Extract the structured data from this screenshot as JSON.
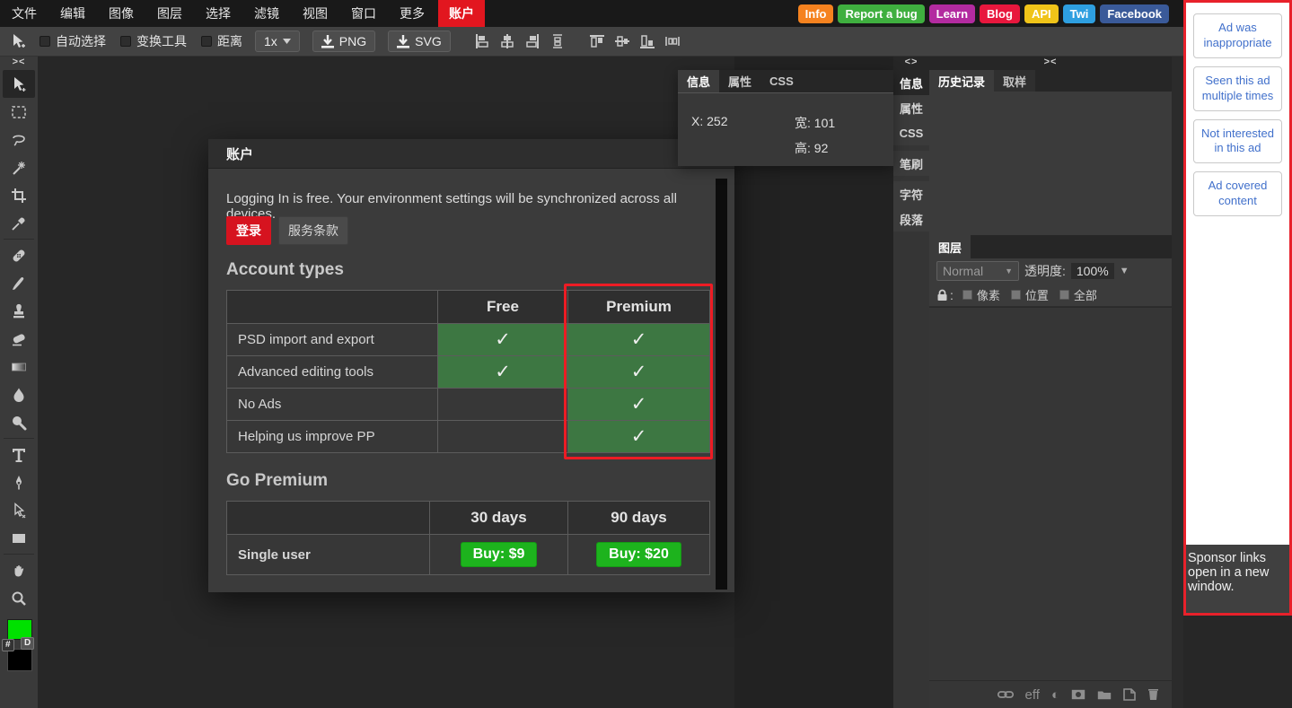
{
  "menu_bar": {
    "items": [
      "文件",
      "编辑",
      "图像",
      "图层",
      "选择",
      "滤镜",
      "视图",
      "窗口",
      "更多"
    ],
    "account_label": "账户",
    "links": [
      {
        "label": "Info",
        "color": "#f5821f"
      },
      {
        "label": "Report a bug",
        "color": "#3faf3f"
      },
      {
        "label": "Learn",
        "color": "#b32ba0"
      },
      {
        "label": "Blog",
        "color": "#e8173d"
      },
      {
        "label": "API",
        "color": "#f0c419"
      },
      {
        "label": "Twi",
        "color": "#2e9fe0"
      },
      {
        "label": "Facebook",
        "color": "#3a5a99"
      }
    ]
  },
  "toolbar": {
    "checkboxes": [
      "自动选择",
      "变换工具",
      "距离"
    ],
    "zoom_select": "1x",
    "png_label": "PNG",
    "svg_label": "SVG"
  },
  "toolstrip": {
    "collapse": "><"
  },
  "swatches": {
    "foreground": "#00e100",
    "background": "#000000",
    "hex_label": "#",
    "default_label": "D"
  },
  "info_panel": {
    "tabs": [
      "信息",
      "属性",
      "CSS"
    ],
    "x_field": "X: 252",
    "w_field": "宽: 101",
    "h_field": "高: 92"
  },
  "side_tabs": {
    "collapse": "<>",
    "items": [
      "信息",
      "属性",
      "CSS",
      "笔刷",
      "字符",
      "段落"
    ]
  },
  "dock": {
    "collapse": "><"
  },
  "history_panel": {
    "tabs": [
      "历史记录",
      "取样"
    ]
  },
  "layers_panel": {
    "tab": "图层",
    "blend_mode": "Normal",
    "opacity_label": "透明度:",
    "opacity_value": "100%",
    "lock_prefix": ":",
    "lock_options": [
      "像素",
      "位置",
      "全部"
    ],
    "eff_label": "eff"
  },
  "dialog": {
    "title": "账户",
    "close_glyph": "✕",
    "intro": "Logging In is free. Your environment settings will be synchronized across all devices.",
    "login_button": "登录",
    "tos_button": "服务条款",
    "account_types": {
      "heading": "Account types",
      "columns": [
        "Free",
        "Premium"
      ],
      "rows": [
        {
          "label": "PSD import and export",
          "free": true,
          "premium": true
        },
        {
          "label": "Advanced editing tools",
          "free": true,
          "premium": true
        },
        {
          "label": "No Ads",
          "free": false,
          "premium": true
        },
        {
          "label": "Helping us improve PP",
          "free": false,
          "premium": true
        }
      ],
      "check_glyph": "✓",
      "highlight_color": "#ed1c24",
      "check_cell_color": "#3d7742"
    },
    "go_premium": {
      "heading": "Go Premium",
      "columns": [
        "30 days",
        "90 days"
      ],
      "rows": [
        {
          "label": "Single user",
          "buttons": [
            "Buy: $9",
            "Buy: $20"
          ]
        }
      ],
      "buy_color": "#1db31d"
    }
  },
  "ad_panel": {
    "feedback_buttons": [
      "Ad was inappropriate",
      "Seen this ad multiple times",
      "Not interested in this ad",
      "Ad covered content"
    ],
    "disclaimer": "Sponsor links open in a new window.",
    "border_color": "#e8212b",
    "link_color": "#4170cb"
  },
  "colors": {
    "accent_red": "#e2161f",
    "workspace": "#272727",
    "panel": "#3b3b3b",
    "panel_header": "#262626"
  }
}
